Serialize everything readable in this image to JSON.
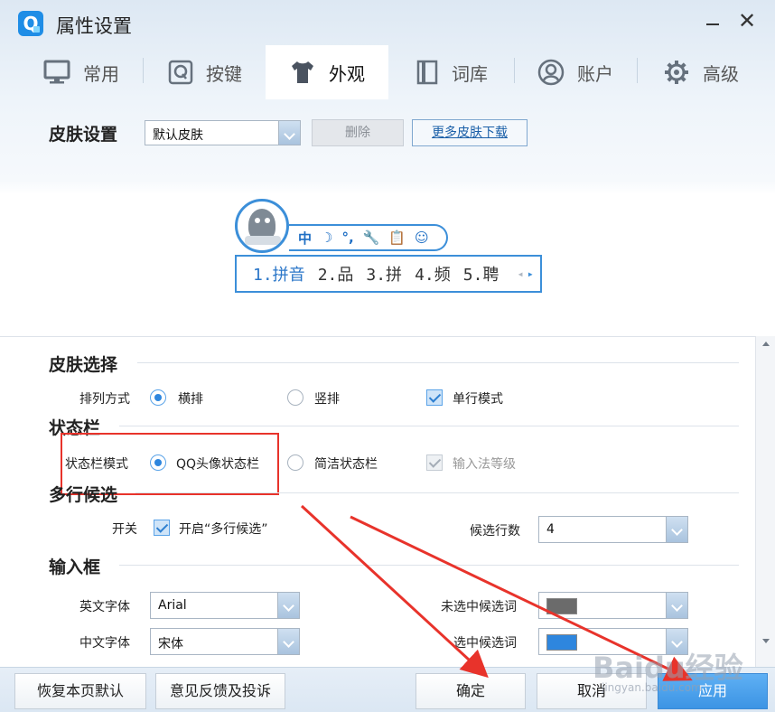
{
  "window": {
    "title": "属性设置",
    "app_logo_letter": "Q"
  },
  "tabs": [
    {
      "label": "常用",
      "icon": "monitor-icon"
    },
    {
      "label": "按键",
      "icon": "key-q-icon"
    },
    {
      "label": "外观",
      "icon": "tshirt-icon",
      "active": true
    },
    {
      "label": "词库",
      "icon": "book-icon"
    },
    {
      "label": "账户",
      "icon": "user-icon"
    },
    {
      "label": "高级",
      "icon": "gear-icon"
    }
  ],
  "skin": {
    "label": "皮肤设置",
    "selected": "默认皮肤",
    "delete_label": "删除",
    "more_label": "更多皮肤下载"
  },
  "preview": {
    "status_icons": [
      "中",
      "☽",
      "°,",
      "🔧",
      "📋",
      "☺"
    ],
    "candidates": [
      "1.拼音",
      "2.品",
      "3.拼",
      "4.频",
      "5.聘"
    ],
    "nav_prev": "◂",
    "nav_next": "▸"
  },
  "sections": {
    "skin_select": {
      "title": "皮肤选择",
      "layout_label": "排列方式",
      "horizontal": "横排",
      "vertical": "竖排",
      "single_line": "单行模式"
    },
    "status_bar": {
      "title": "状态栏",
      "mode_label": "状态栏模式",
      "qq_avatar": "QQ头像状态栏",
      "simple": "简洁状态栏",
      "ime_level": "输入法等级"
    },
    "multi_line": {
      "title": "多行候选",
      "switch_label": "开关",
      "enable_label": "开启“多行候选”",
      "rows_label": "候选行数",
      "rows_value": "4"
    },
    "input_box": {
      "title": "输入框",
      "en_font_label": "英文字体",
      "en_font_value": "Arial",
      "zh_font_label": "中文字体",
      "zh_font_value": "宋体",
      "unselected_label": "未选中候选词",
      "unselected_color": "#6b6b6b",
      "selected_label": "选中候选词",
      "selected_color": "#2e86de"
    }
  },
  "bottom": {
    "restore": "恢复本页默认",
    "feedback": "意见反馈及投诉",
    "ok": "确定",
    "cancel": "取消",
    "apply": "应用"
  },
  "watermark": {
    "main": "Baidu经验",
    "sub": "jingyan.baidu.com"
  },
  "colors": {
    "accent": "#2e86de",
    "annotation": "#e8332b"
  }
}
